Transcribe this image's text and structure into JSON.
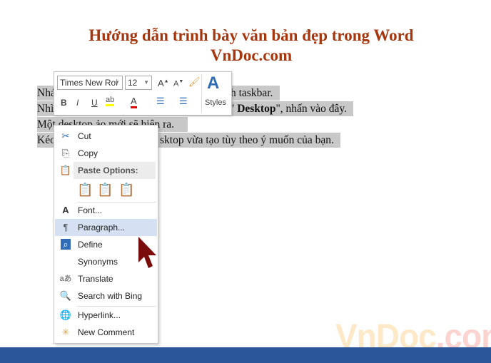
{
  "document": {
    "title_line1": "Hướng dẫn trình bày văn bản đẹp trong Word",
    "title_line2": "VnDoc.com",
    "lines": [
      {
        "visible_start": "Nhá",
        "visible_end": "h taskbar."
      },
      {
        "visible_start": "Nhì",
        "visible_mid": "\" ",
        "bold": "Desktop",
        "visible_end": "\", nhấn vào đây."
      },
      {
        "text": "Một desktop ảo mới sẽ hiện ra."
      },
      {
        "visible_start": "Kéo",
        "visible_end": "sktop vừa tạo tùy theo ý muốn của bạn."
      }
    ]
  },
  "mini_toolbar": {
    "font_name": "Times New Roi",
    "font_size": "12",
    "bold": "B",
    "italic": "I",
    "underline": "U",
    "highlight_color": "#ffff00",
    "font_color": "#e00000",
    "styles_label": "Styles"
  },
  "context_menu": {
    "items": [
      {
        "label": "Cut",
        "icon": "scissors-icon"
      },
      {
        "label": "Copy",
        "icon": "copy-icon"
      },
      {
        "label": "Paste Options:",
        "icon": "clipboard-icon"
      },
      {
        "label": "Font...",
        "icon": "font-icon"
      },
      {
        "label": "Paragraph...",
        "icon": "paragraph-icon",
        "highlighted": true
      },
      {
        "label": "Define",
        "icon": "define-icon"
      },
      {
        "label": "Synonyms"
      },
      {
        "label": "Translate",
        "icon": "translate-icon"
      },
      {
        "label": "Search with Bing",
        "icon": "search-globe-icon"
      },
      {
        "label": "Hyperlink...",
        "icon": "hyperlink-icon"
      },
      {
        "label": "New Comment",
        "icon": "comment-icon"
      }
    ]
  },
  "watermark": {
    "part1": "VnDoc",
    "part2": ".com"
  },
  "colors": {
    "title": "#a5360e",
    "highlight": "#c8c8c8",
    "status_bar": "#2b579a",
    "cursor": "#7a0c0c",
    "menu_hover": "#d5e1f2"
  }
}
